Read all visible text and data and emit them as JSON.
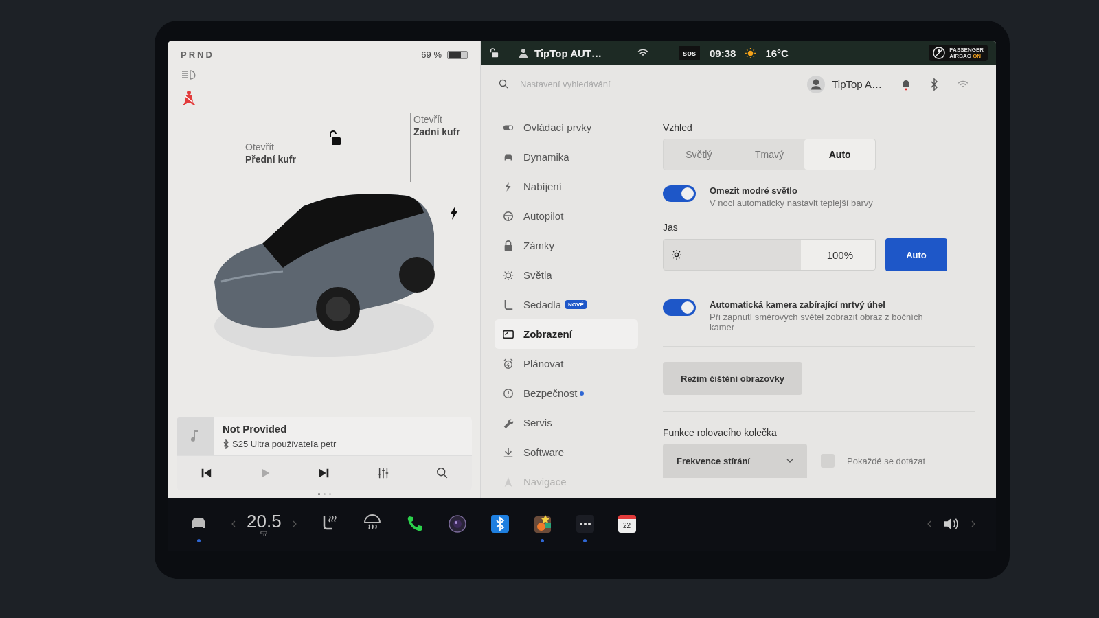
{
  "left_panel": {
    "gears": "PRND",
    "battery_percent": "69 %",
    "battery": {
      "level": 0.69
    },
    "car_labels": [
      {
        "kind": "frunk",
        "line1": "Otevřít",
        "line2": "Přední kufr"
      },
      {
        "kind": "trunk",
        "line1": "Otevřít",
        "line2": "Zadní kufr"
      }
    ],
    "media": {
      "title": "Not Provided",
      "source": "S25 Ultra používateľa petr",
      "controls": [
        {
          "kind": "prev",
          "disabled": false
        },
        {
          "kind": "play",
          "disabled": true
        },
        {
          "kind": "next",
          "disabled": false
        },
        {
          "kind": "eq",
          "disabled": false
        },
        {
          "kind": "search",
          "disabled": false
        }
      ],
      "pages": [
        {
          "selected": true
        },
        {
          "selected": false
        },
        {
          "selected": false
        }
      ]
    }
  },
  "status_bar": {
    "profile": "TipTop AUT…",
    "sos": "sos",
    "time": "09:38",
    "temperature": "16°C",
    "airbag": {
      "line1": "PASSENGER",
      "line2_a": "AIRBAG",
      "line2_b": "ON"
    }
  },
  "header": {
    "search": {
      "placeholder": "Nastavení vyhledávání"
    },
    "profile": "TipTop A…",
    "notification": true
  },
  "sidebar": {
    "items": [
      {
        "label": "Ovládací prvky",
        "selected": false,
        "disabled": false
      },
      {
        "label": "Dynamika",
        "selected": false,
        "disabled": false
      },
      {
        "label": "Nabíjení",
        "selected": false,
        "disabled": false
      },
      {
        "label": "Autopilot",
        "selected": false,
        "disabled": false
      },
      {
        "label": "Zámky",
        "selected": false,
        "disabled": false
      },
      {
        "label": "Světla",
        "selected": false,
        "disabled": false
      },
      {
        "label": "Sedadla",
        "selected": false,
        "disabled": false,
        "badge": "NOVÉ"
      },
      {
        "label": "Zobrazení",
        "selected": true,
        "disabled": false
      },
      {
        "label": "Plánovat",
        "selected": false,
        "disabled": false
      },
      {
        "label": "Bezpečnost",
        "selected": false,
        "disabled": false,
        "dot": true
      },
      {
        "label": "Servis",
        "selected": false,
        "disabled": false
      },
      {
        "label": "Software",
        "selected": false,
        "disabled": false
      },
      {
        "label": "Navigace",
        "selected": false,
        "disabled": true
      }
    ]
  },
  "settings": {
    "appearance": {
      "label": "Vzhled",
      "options": [
        {
          "label": "Světlý",
          "selected": false
        },
        {
          "label": "Tmavý",
          "selected": false
        },
        {
          "label": "Auto",
          "selected": true
        }
      ]
    },
    "blue_light": {
      "on": true,
      "title": "Omezit modré světlo",
      "description": "V noci automaticky nastavit teplejší barvy"
    },
    "brightness": {
      "label": "Jas",
      "level": 1.0,
      "reading": "100%",
      "auto": {
        "label": "Auto",
        "selected": true
      }
    },
    "blind_spot": {
      "on": true,
      "title": "Automatická kamera zabírající mrtvý úhel",
      "description": "Při zapnutí směrových světel zobrazit obraz z bočních kamer"
    },
    "clean_button": "Režim čištění obrazovky",
    "scroll_wheel": {
      "label": "Funkce rolovacího kolečka",
      "value": "Frekvence stírání",
      "ask": {
        "label": "Pokaždé se dotázat",
        "checked": false
      }
    }
  },
  "taskbar": [
    {
      "kind": "car",
      "indicator": true
    },
    {
      "kind": "climate",
      "value": "20.5",
      "indicator": false
    },
    {
      "kind": "seat",
      "indicator": false
    },
    {
      "kind": "defrost",
      "indicator": false
    },
    {
      "kind": "phone",
      "indicator": false
    },
    {
      "kind": "camera",
      "indicator": false
    },
    {
      "kind": "bluetooth",
      "indicator": false
    },
    {
      "kind": "games",
      "indicator": true
    },
    {
      "kind": "more",
      "indicator": true
    },
    {
      "kind": "calendar",
      "value": "22",
      "indicator": false
    },
    {
      "kind": "volume",
      "indicator": false
    }
  ]
}
